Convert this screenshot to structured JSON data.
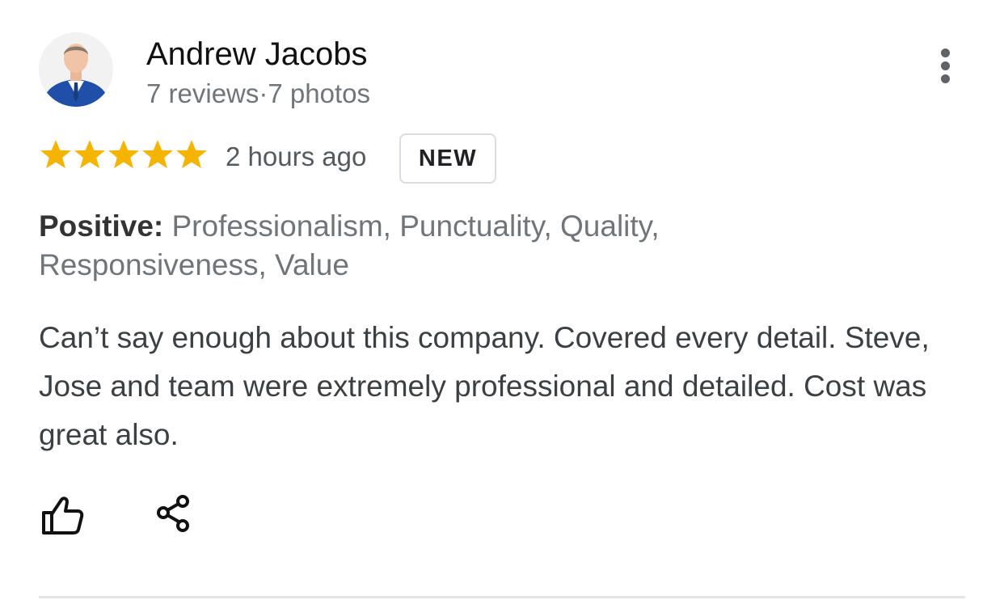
{
  "review": {
    "author": {
      "name": "Andrew Jacobs",
      "meta": "7 reviews·7 photos",
      "avatar_icon": "person-avatar"
    },
    "rating": {
      "stars": 5,
      "max_stars": 5,
      "star_color": "#f4b400"
    },
    "time_ago": "2 hours ago",
    "badge": "NEW",
    "attributes": {
      "label": "Positive:",
      "values": "Professionalism, Punctuality, Quality, Responsiveness, Value"
    },
    "text": "Can’t say enough about this company. Covered every detail. Steve, Jose and team were extremely professional and detailed. Cost was great also.",
    "actions": {
      "like_icon": "thumbs-up-icon",
      "share_icon": "share-icon",
      "more_icon": "more-vertical-icon"
    }
  }
}
